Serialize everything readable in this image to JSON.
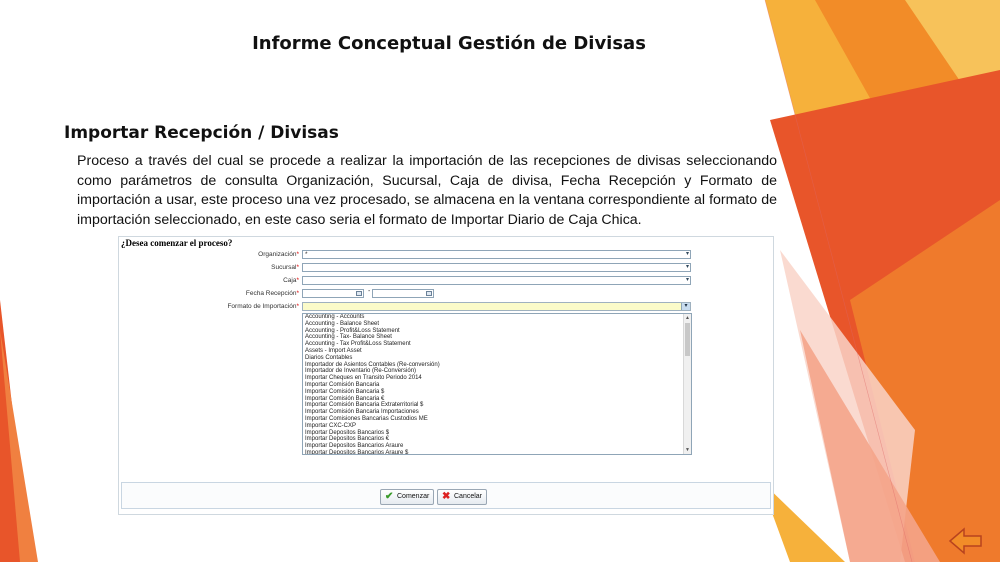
{
  "slide": {
    "title": "Informe Conceptual Gestión de Divisas",
    "heading": "Importar Recepción / Divisas",
    "paragraph": "Proceso a través del cual se procede a realizar la importación de las recepciones de divisas seleccionando como parámetros de consulta Organización, Sucursal, Caja de divisa, Fecha Recepción y Formato de importación a usar, este proceso una vez procesado, se almacena en la ventana correspondiente al formato de importación seleccionado, en este caso seria el formato de Importar Diario de Caja Chica."
  },
  "dialog": {
    "question": "¿Desea comenzar el proceso?",
    "fields": {
      "organizacion": {
        "label": "Organización",
        "value": "*"
      },
      "sucursal": {
        "label": "Sucursal",
        "value": ""
      },
      "caja": {
        "label": "Caja",
        "value": ""
      },
      "fecha": {
        "label": "Fecha Recepción",
        "from": "",
        "to": "",
        "separator": "-"
      },
      "formato": {
        "label": "Formato de Importación",
        "value": ""
      }
    },
    "required_marker": "*",
    "formato_options": [
      "Accounting - Accounts",
      "Accounting - Balance Sheet",
      "Accounting - Profit&Loss Statement",
      "Accounting - Tax- Balance Sheet",
      "Accounting - Tax Profit&Loss Statement",
      "Assets - Import Asset",
      "Diarios Contables",
      "Importador de Asientos Contables (Re-conversión)",
      "Importador de Inventario (Re-Conversión)",
      "Importar Cheques en Transito Periodo 2014",
      "Importar Comisión Bancaria",
      "Importar Comisión Bancaria $",
      "Importar Comisión Bancaria €",
      "Importar Comisión Bancaria Extraterritorial $",
      "Importar Comisión Bancaria Importaciones",
      "Importar Comisiones Bancarias Custodios ME",
      "Importar CXC-CXP",
      "Importar Depositos Bancarios $",
      "Importar Depositos Bancarios €",
      "Importar Depositos Bancarios Araure",
      "Importar Depositos Bancarios Araure $"
    ],
    "buttons": {
      "ok": "Comenzar",
      "cancel": "Cancelar"
    }
  },
  "colors": {
    "orange_dark": "#e8552a",
    "orange": "#f28c28",
    "amber": "#f6b13b",
    "peach": "#f4a48a",
    "highlight_field": "#fbfbc9"
  },
  "icons": [
    "check-icon",
    "cross-icon",
    "calendar-icon",
    "chevron-down-icon",
    "back-arrow-icon"
  ]
}
